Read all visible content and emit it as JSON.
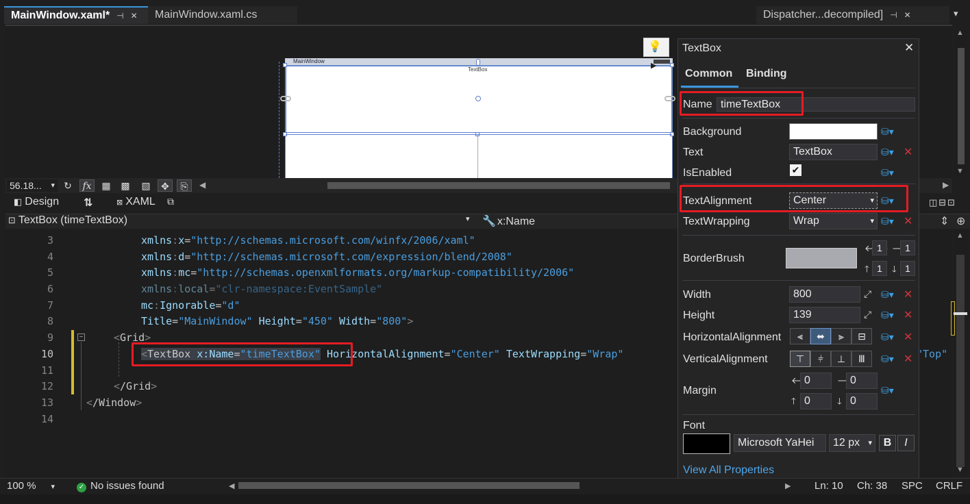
{
  "tabs": [
    {
      "label": "MainWindow.xaml*",
      "pin": "⊣",
      "close": "✕"
    },
    {
      "label": "MainWindow.xaml.cs"
    },
    {
      "label": "Dispatcher...decompiled]",
      "pin": "⊣",
      "close": "✕",
      "more": "▾"
    }
  ],
  "designer": {
    "window_title": "MainWindow",
    "textbox_text": "TextBox",
    "zoom": "56.18...",
    "dropdown": "▾"
  },
  "view_tabs": {
    "design": "Design",
    "swap": "⇅",
    "xaml": "XAML"
  },
  "nav": {
    "element": "TextBox (timeTextBox)",
    "member": "x:Name"
  },
  "code": {
    "line_numbers": [
      "3",
      "4",
      "5",
      "6",
      "7",
      "8",
      "9",
      "10",
      "11",
      "12",
      "13",
      "14"
    ],
    "l3": {
      "attr": "xmlns",
      "ns": "x",
      "val": "\"http://schemas.microsoft.com/winfx/2006/xaml\""
    },
    "l4": {
      "attr": "xmlns",
      "ns": "d",
      "val": "\"http://schemas.microsoft.com/expression/blend/2008\""
    },
    "l5": {
      "attr": "xmlns",
      "ns": "mc",
      "val": "\"http://schemas.openxmlformats.org/markup-compatibility/2006\""
    },
    "l6": {
      "attr": "xmlns",
      "ns": "local",
      "val": "\"clr-namespace:EventSample\""
    },
    "l7": {
      "ns": "mc",
      "attr": "Ignorable",
      "val": "\"d\""
    },
    "l8": {
      "a1": "Title",
      "v1": "\"MainWindow\"",
      "a2": "Height",
      "v2": "\"450\"",
      "a3": "Width",
      "v3": "\"800\""
    },
    "l9": {
      "tag": "Grid"
    },
    "l10": {
      "tag": "TextBox",
      "a1": "x:Name",
      "v1": "\"timeTextBox\"",
      "a2": "HorizontalAlignment",
      "v2": "\"Center\"",
      "a3": "TextWrapping",
      "v3": "\"Wrap\"",
      "tail": "\"Top\""
    },
    "l12": {
      "tag": "/Grid"
    },
    "l13": {
      "tag": "/Window"
    }
  },
  "props": {
    "title": "TextBox",
    "close": "✕",
    "tab_common": "Common",
    "tab_binding": "Binding",
    "name_label": "Name",
    "name_value": "timeTextBox",
    "background_label": "Background",
    "text_label": "Text",
    "text_value": "TextBox",
    "isenabled_label": "IsEnabled",
    "isenabled_check": "✔",
    "textalignment_label": "TextAlignment",
    "textalignment_value": "Center",
    "textwrapping_label": "TextWrapping",
    "textwrapping_value": "Wrap",
    "borderbrush_label": "BorderBrush",
    "border_thickness": [
      "1",
      "1",
      "1",
      "1"
    ],
    "width_label": "Width",
    "width_value": "800",
    "height_label": "Height",
    "height_value": "139",
    "halign_label": "HorizontalAlignment",
    "valign_label": "VerticalAlignment",
    "margin_label": "Margin",
    "margin_values": [
      "0",
      "0",
      "0",
      "0"
    ],
    "font_label": "Font",
    "font_family": "Microsoft YaHei",
    "font_size": "12 px",
    "bold": "B",
    "italic": "I",
    "view_all": "View All Properties",
    "colors": {
      "background_swatch": "#ffffff",
      "border_swatch": "#a9a9b0",
      "font_swatch": "#000000"
    }
  },
  "status": {
    "zoom": "100 %",
    "issues": "No issues found",
    "ln": "Ln: 10",
    "ch": "Ch: 38",
    "spc": "SPC",
    "crlf": "CRLF"
  },
  "colors": {
    "accent": "#3a96dd",
    "highlight": "#e51c23",
    "ok": "#2ea043"
  }
}
